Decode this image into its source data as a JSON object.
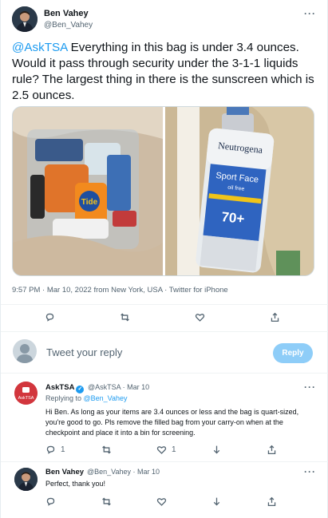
{
  "main_tweet": {
    "author_name": "Ben Vahey",
    "author_handle": "@Ben_Vahey",
    "more": "···",
    "mention": "@AskTSA",
    "text": " Everything in this bag is under 3.4 ounces. Would it pass through security under the 3-1-1 liquids rule? The largest thing in there is the sunscreen which is 2.5 ounces.",
    "meta": "9:57 PM · Mar 10, 2022 from New York, USA · Twitter for iPhone",
    "media": {
      "left_photo_label": "Tide",
      "right_photo_brand": "Neutrogena",
      "right_photo_line1": "Sport Face",
      "right_photo_line2": "oil free",
      "right_photo_spf": "70+"
    }
  },
  "reply_composer": {
    "placeholder": "Tweet your reply",
    "button_label": "Reply"
  },
  "replies": [
    {
      "author_name": "AskTSA",
      "verified_mark": "✓",
      "author_handle": "@AskTSA",
      "date": "· Mar 10",
      "more": "···",
      "replying_prefix": "Replying to ",
      "replying_handle": "@Ben_Vahey",
      "text": "Hi Ben. As long as your items are 3.4 ounces or less and the bag is quart-sized, you're good to go. Pls remove the filled bag from your carry-on when at the checkpoint and place it into a bin for screening.",
      "reply_count": "1",
      "like_count": "1",
      "avatar_text": "AskTSA",
      "brand_color": "#d2363d"
    },
    {
      "author_name": "Ben Vahey",
      "author_handle": "@Ben_Vahey",
      "date": "· Mar 10",
      "more": "···",
      "text": "Perfect, thank you!"
    }
  ],
  "colors": {
    "accent": "#1d9bf0",
    "reply_button": "#8ecdf8",
    "muted_text": "#536471"
  }
}
